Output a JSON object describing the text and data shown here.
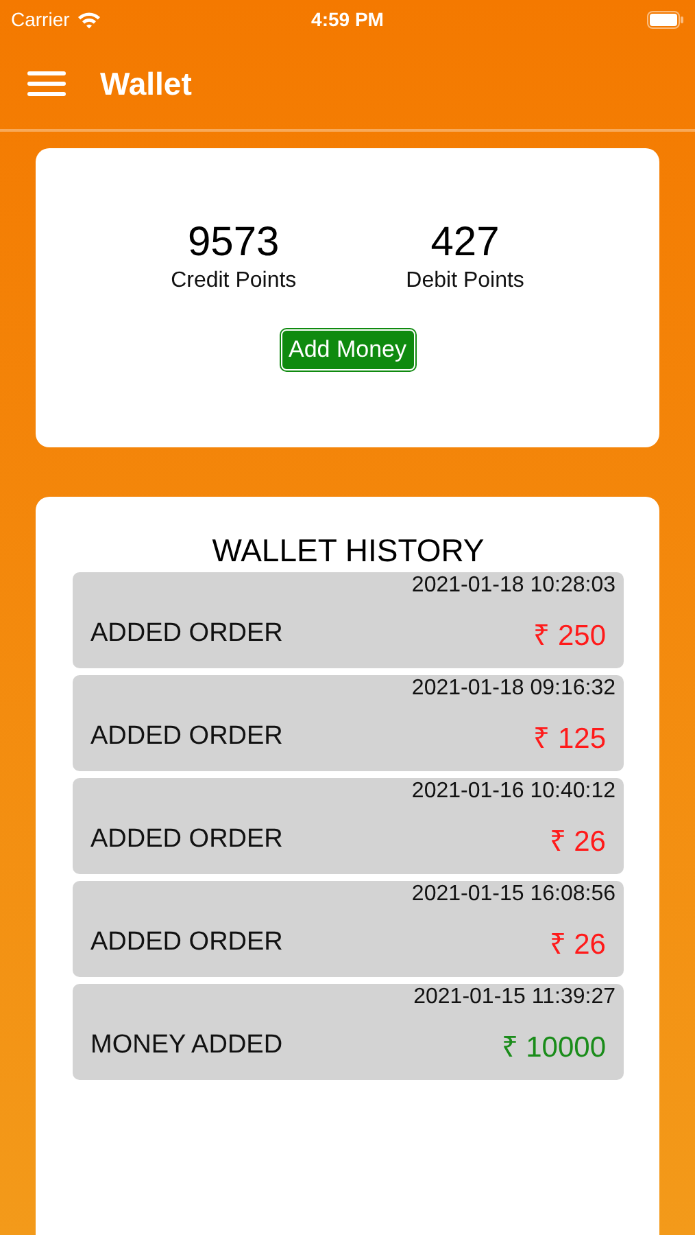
{
  "status_bar": {
    "carrier": "Carrier",
    "time": "4:59 PM"
  },
  "header": {
    "title": "Wallet"
  },
  "summary": {
    "stats": [
      {
        "value": "9573",
        "label": "Credit Points"
      },
      {
        "value": "427",
        "label": "Debit Points"
      }
    ],
    "button": "Add Money"
  },
  "history": {
    "title": "WALLET HISTORY",
    "rows": [
      {
        "timestamp": "2021-01-18 10:28:03",
        "description": "ADDED ORDER",
        "amount": "₹ 250",
        "color": "#ff1a1a"
      },
      {
        "timestamp": "2021-01-18 09:16:32",
        "description": "ADDED ORDER",
        "amount": "₹ 125",
        "color": "#ff1a1a"
      },
      {
        "timestamp": "2021-01-16 10:40:12",
        "description": "ADDED ORDER",
        "amount": "₹ 26",
        "color": "#ff1a1a"
      },
      {
        "timestamp": "2021-01-15 16:08:56",
        "description": "ADDED ORDER",
        "amount": "₹ 26",
        "color": "#ff1a1a"
      },
      {
        "timestamp": "2021-01-15 11:39:27",
        "description": "MONEY ADDED",
        "amount": "₹ 10000",
        "color": "#1a8c1a"
      }
    ]
  }
}
